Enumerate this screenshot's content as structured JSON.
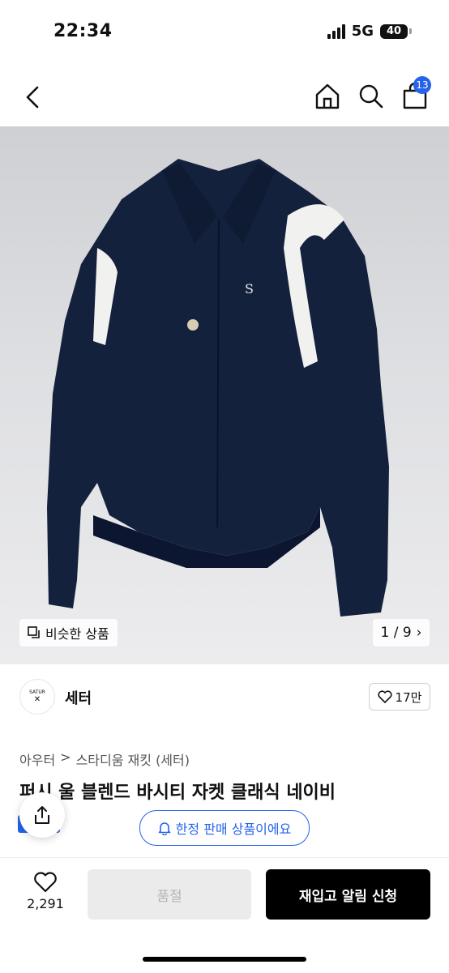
{
  "status_bar": {
    "time": "22:34",
    "network": "5G",
    "battery": "40"
  },
  "nav": {
    "cart_count": "13",
    "icons": [
      "back-icon",
      "home-icon",
      "search-icon",
      "cart-icon"
    ]
  },
  "gallery": {
    "similar_label": "비슷한 상품",
    "counter": "1 / 9"
  },
  "brand": {
    "logo_text": "SATUR",
    "name": "세터",
    "likes": "17만"
  },
  "breadcrumb": {
    "category": "아우터",
    "separator": ">",
    "subcategory": "스타디움 재킷 (세터)"
  },
  "product": {
    "title": "퍼시 울 블렌드 바시티 자켓 클래식 네이비"
  },
  "notice": {
    "limited_label": "한정 판매 상품이에요"
  },
  "bottom": {
    "wish_count": "2,291",
    "soldout_label": "품절",
    "restock_label": "재입고 알림 신청"
  },
  "colors": {
    "accent": "#2563eb",
    "jacket": "#14213d"
  }
}
